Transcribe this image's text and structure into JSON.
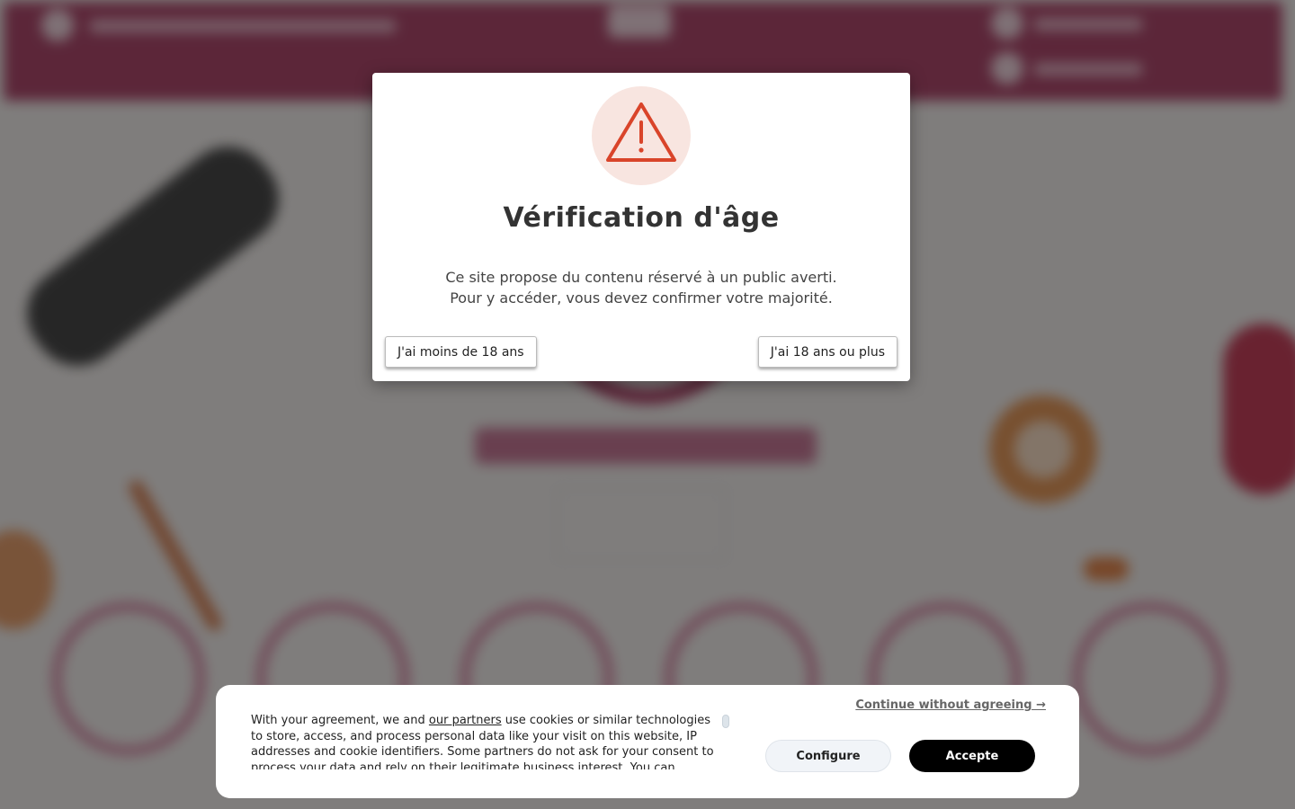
{
  "age_gate": {
    "icon": "warning-triangle-icon",
    "title": "Vérification d'âge",
    "message_line1": "Ce site propose du contenu réservé à un public averti.",
    "message_line2": "Pour y accéder, vous devez confirmer votre majorité.",
    "under_18_label": "J'ai moins de 18 ans",
    "over_18_label": "J'ai 18 ans ou plus",
    "accent_color": "#d9442a"
  },
  "cookie_banner": {
    "text_before_link": "With your agreement, we and ",
    "partners_link": "our partners",
    "text_after_link": " use cookies or similar technologies to store, access, and process personal data like your visit on this website, IP addresses and cookie identifiers. Some partners do not ask for your consent to process your data and rely on their legitimate business interest. You can",
    "continue_label": "Continue without agreeing →",
    "configure_label": "Configure",
    "accept_label": "Accepte"
  },
  "colors": {
    "brand": "#b04a6e",
    "overlay": "rgba(0,0,0,0.48)"
  }
}
